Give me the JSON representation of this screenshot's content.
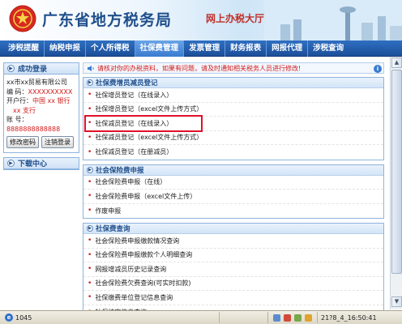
{
  "header": {
    "title": "广东省地方税务局",
    "subtitle": "网上办税大厅"
  },
  "nav": {
    "items": [
      "涉税提醒",
      "纳税申报",
      "个人所得税",
      "社保费管理",
      "发票管理",
      "财务报表",
      "网报代理",
      "涉税查询"
    ],
    "active_index": 3
  },
  "login": {
    "title": "成功登录",
    "company": "xx市xx贸易有限公司",
    "code_label": "编    码：",
    "code_value": "XXXXXXXXXX",
    "bank_label": "开户行：",
    "bank_value_1": "中国 xx 银行",
    "bank_value_2": "xx 支行",
    "account_label": "账    号：",
    "account_value": "8888888888888",
    "btn_change_pwd": "修改密码",
    "btn_logout": "注销登录"
  },
  "download": {
    "title": "下载中心"
  },
  "notice": {
    "text": "请核对你的办税资料，如果有问题，请及时通知相关税务人员进行修改!"
  },
  "sections": [
    {
      "title": "社保费增员减员登记",
      "items": [
        "社保增员登记（在线录入）",
        "社保增员登记（excel文件上传方式）",
        "社保减员登记（在线录入）",
        "社保减员登记（excel文件上传方式）",
        "社保减员登记（在册减员）"
      ],
      "highlighted_index": 2
    },
    {
      "title": "社会保险费申报",
      "items": [
        "社会保险费申报（在线）",
        "社会保险费申报（excel文件上传）",
        "作废申报"
      ]
    },
    {
      "title": "社保费查询",
      "items": [
        "社会保险费申报缴款情况查询",
        "社会保险费申报缴款个人明细查询",
        "网报增减员历史记录查询",
        "社会保险费欠费查询(可实时扣款)",
        "社保缴费单位登记信息查询",
        "社保核定信息查询"
      ]
    }
  ],
  "status_bar": {
    "count": "1045",
    "time": "21?8_4_16:50:41"
  }
}
